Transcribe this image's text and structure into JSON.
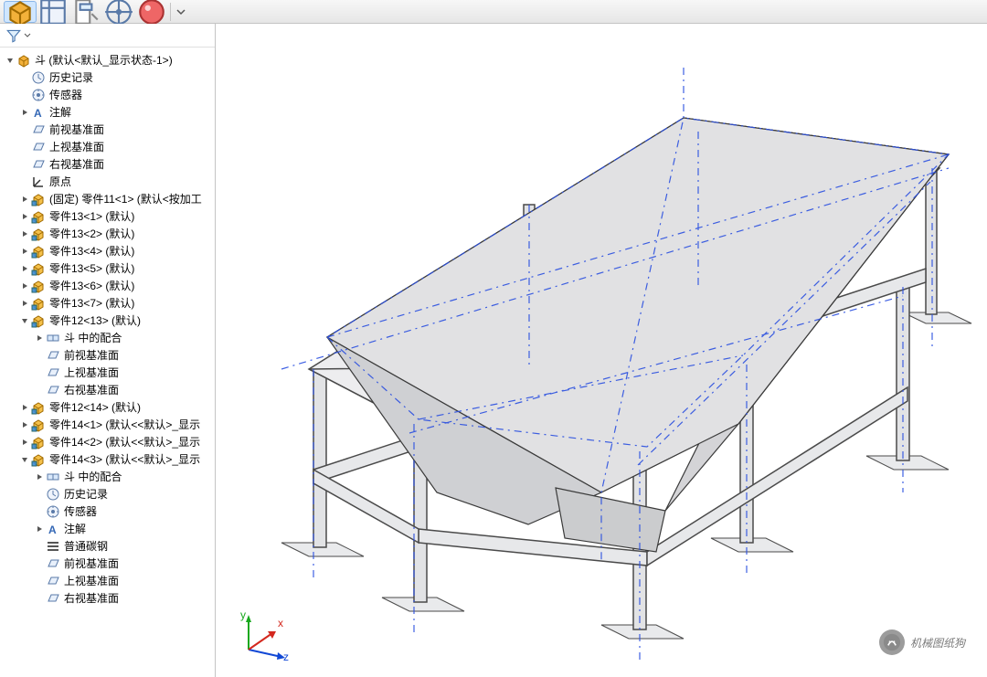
{
  "toolbar": {
    "tabs": [
      {
        "name": "assembly"
      },
      {
        "name": "layout"
      },
      {
        "name": "clipboard"
      },
      {
        "name": "target"
      },
      {
        "name": "appearance"
      }
    ]
  },
  "tree": {
    "root": {
      "label": "斗  (默认<默认_显示状态-1>)",
      "icon": "assembly",
      "expanded": true
    },
    "items": [
      {
        "indent": 1,
        "expand": "none",
        "icon": "history",
        "label": "历史记录"
      },
      {
        "indent": 1,
        "expand": "none",
        "icon": "sensor",
        "label": "传感器"
      },
      {
        "indent": 1,
        "expand": "closed",
        "icon": "annotation",
        "label": "注解"
      },
      {
        "indent": 1,
        "expand": "none",
        "icon": "plane",
        "label": "前视基准面"
      },
      {
        "indent": 1,
        "expand": "none",
        "icon": "plane",
        "label": "上视基准面"
      },
      {
        "indent": 1,
        "expand": "none",
        "icon": "plane",
        "label": "右视基准面"
      },
      {
        "indent": 1,
        "expand": "none",
        "icon": "origin",
        "label": "原点"
      },
      {
        "indent": 1,
        "expand": "closed",
        "icon": "part",
        "label": "(固定) 零件11<1> (默认<按加工"
      },
      {
        "indent": 1,
        "expand": "closed",
        "icon": "part",
        "label": "零件13<1> (默认)"
      },
      {
        "indent": 1,
        "expand": "closed",
        "icon": "part",
        "label": "零件13<2> (默认)"
      },
      {
        "indent": 1,
        "expand": "closed",
        "icon": "part",
        "label": "零件13<4> (默认)"
      },
      {
        "indent": 1,
        "expand": "closed",
        "icon": "part",
        "label": "零件13<5> (默认)"
      },
      {
        "indent": 1,
        "expand": "closed",
        "icon": "part",
        "label": "零件13<6> (默认)"
      },
      {
        "indent": 1,
        "expand": "closed",
        "icon": "part",
        "label": "零件13<7> (默认)"
      },
      {
        "indent": 1,
        "expand": "open",
        "icon": "part",
        "label": "零件12<13> (默认)"
      },
      {
        "indent": 2,
        "expand": "closed",
        "icon": "mates",
        "label": "斗 中的配合"
      },
      {
        "indent": 2,
        "expand": "none",
        "icon": "plane",
        "label": "前视基准面"
      },
      {
        "indent": 2,
        "expand": "none",
        "icon": "plane",
        "label": "上视基准面"
      },
      {
        "indent": 2,
        "expand": "none",
        "icon": "plane",
        "label": "右视基准面"
      },
      {
        "indent": 1,
        "expand": "closed",
        "icon": "part",
        "label": "零件12<14> (默认)"
      },
      {
        "indent": 1,
        "expand": "closed",
        "icon": "part",
        "label": "零件14<1> (默认<<默认>_显示"
      },
      {
        "indent": 1,
        "expand": "closed",
        "icon": "part",
        "label": "零件14<2> (默认<<默认>_显示"
      },
      {
        "indent": 1,
        "expand": "open",
        "icon": "part",
        "label": "零件14<3> (默认<<默认>_显示"
      },
      {
        "indent": 2,
        "expand": "closed",
        "icon": "mates",
        "label": "斗 中的配合"
      },
      {
        "indent": 2,
        "expand": "none",
        "icon": "history",
        "label": "历史记录"
      },
      {
        "indent": 2,
        "expand": "none",
        "icon": "sensor",
        "label": "传感器"
      },
      {
        "indent": 2,
        "expand": "closed",
        "icon": "annotation",
        "label": "注解"
      },
      {
        "indent": 2,
        "expand": "none",
        "icon": "material",
        "label": "普通碳钢"
      },
      {
        "indent": 2,
        "expand": "none",
        "icon": "plane",
        "label": "前视基准面"
      },
      {
        "indent": 2,
        "expand": "none",
        "icon": "plane",
        "label": "上视基准面"
      },
      {
        "indent": 2,
        "expand": "none",
        "icon": "plane",
        "label": "右视基准面"
      }
    ]
  },
  "triad": {
    "x": "x",
    "y": "y",
    "z": "z"
  },
  "watermark": {
    "text": "机械图纸狗"
  }
}
